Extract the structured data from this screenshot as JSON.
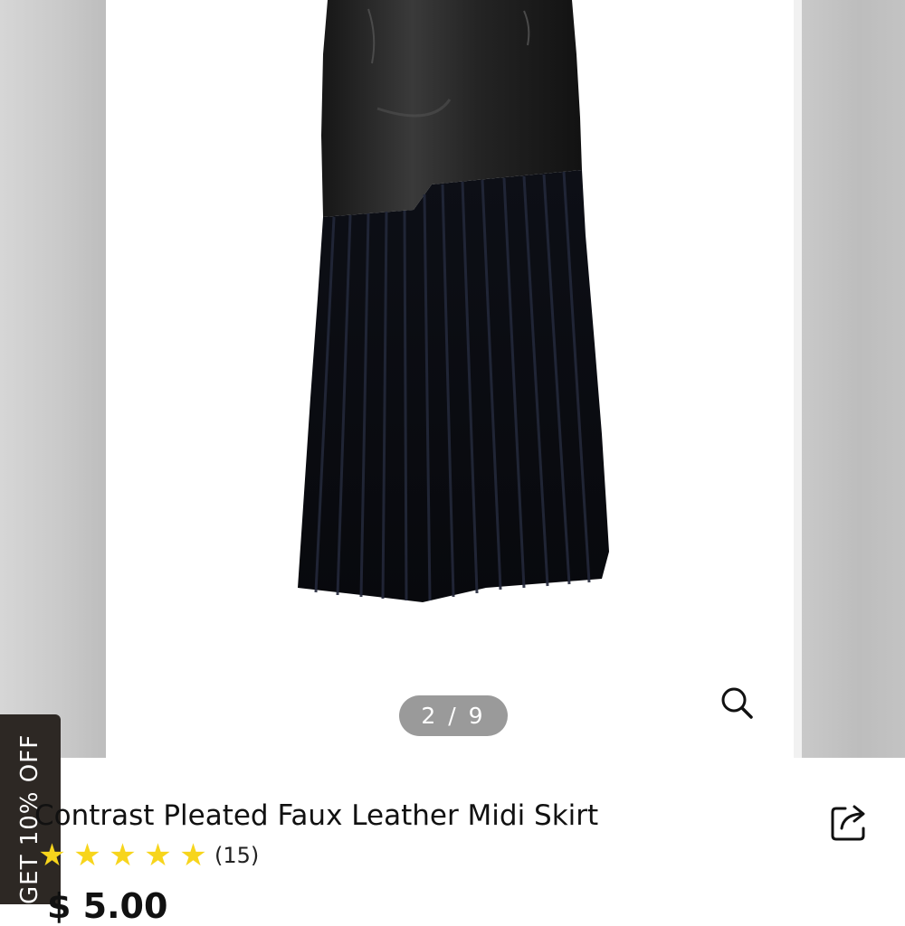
{
  "gallery": {
    "counter": "2 / 9",
    "current_image": 2,
    "total_images": 9
  },
  "promo": {
    "tab_label": "GET 10% OFF"
  },
  "product": {
    "title": "Contrast Pleated Faux Leather Midi Skirt",
    "rating": 5,
    "review_count": "(15)",
    "price": "$ 5.00"
  },
  "colors": {
    "star": "#f7d51c",
    "promo_background": "#2d2824",
    "counter_background": "#9a9a9a"
  },
  "icons": {
    "zoom": "magnifier-icon",
    "share": "share-icon",
    "star": "star-icon"
  }
}
